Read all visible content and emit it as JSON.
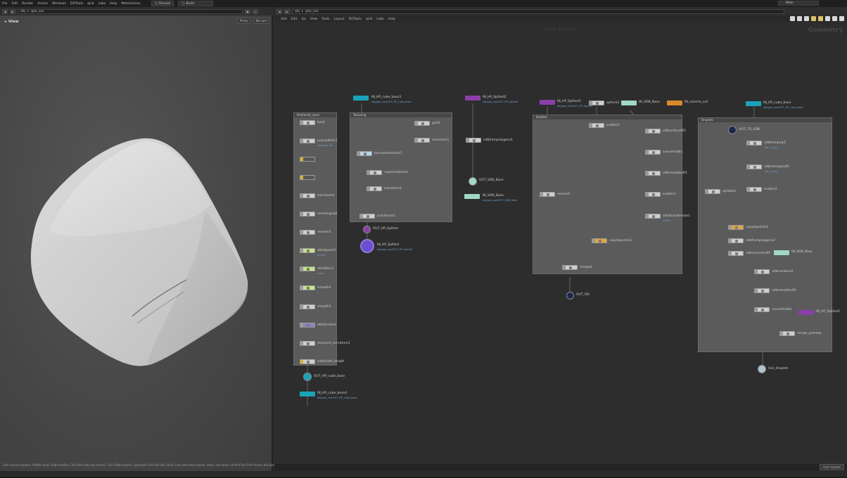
{
  "menubar": {
    "items": [
      "File",
      "Edit",
      "Render",
      "Assets",
      "Windows",
      "DOTools",
      "qLib",
      "Labs",
      "Help",
      "MetaHuman"
    ],
    "desktop_tab": "Recook",
    "desktop_select": "Build",
    "main_label": "Main"
  },
  "viewport": {
    "path": "obj",
    "node": "geo_vox",
    "view_label": "View",
    "persp_label": "Persp",
    "cam_label": "No cam",
    "status_text": "Left mouse tumbles. Middle pans. Right dollies. Ctrl+Alt+Left box zooms. Ctrl+Right zooms. Spacebar-Ctrl-Left tilts. Hold L for alternate tumble, dolly, and zoom. Hold M for First Person Navigation."
  },
  "network": {
    "path": "obj",
    "node": "geo_vox",
    "menus": [
      "Add",
      "Edit",
      "Go",
      "View",
      "Tools",
      "Layout",
      "DOTools",
      "qLib",
      "Labs",
      "Help"
    ],
    "context_label": "Geometry",
    "center_watermark": "Indie Edition",
    "auto_update": "Auto Update"
  },
  "boxes": [
    {
      "id": "polyfamily_base",
      "title": "Polyfamily_base"
    },
    {
      "id": "texturing",
      "title": "Texturing"
    },
    {
      "id": "bubbles",
      "title": "Bubbles"
    },
    {
      "id": "droplets",
      "title": "Droplets"
    }
  ],
  "nodes": {
    "box1": [
      {
        "label": "box1",
        "sub": ""
      },
      {
        "label": "polysplitdiv1",
        "sub": "tangents: fill"
      },
      {
        "label": "",
        "sub": ""
      },
      {
        "label": "",
        "sub": ""
      },
      {
        "label": "transform1",
        "sub": ""
      },
      {
        "label": "remeshgrid2",
        "sub": ""
      },
      {
        "label": "remesh1",
        "sub": ""
      },
      {
        "label": "attribpaint1",
        "sub": "pscale"
      },
      {
        "label": "attribblur1",
        "sub": "mask"
      },
      {
        "label": "smooth2",
        "sub": "0"
      },
      {
        "label": "smooth1",
        "sub": "0"
      },
      {
        "label": "attribnoise1",
        "sub": ""
      },
      {
        "label": "measure_curvature1",
        "sub": ""
      },
      {
        "label": "subdivide_length",
        "sub": ""
      }
    ],
    "tex": [
      {
        "label": "grid1",
        "sub": ""
      },
      {
        "label": "mountain1",
        "sub": ""
      },
      {
        "label": "boundsstretcher1",
        "sub": ""
      },
      {
        "label": "rayhitcollision1",
        "sub": ""
      },
      {
        "label": "transform1",
        "sub": ""
      },
      {
        "label": "pointnorm1",
        "sub": ""
      }
    ],
    "bub": [
      {
        "label": "sphere1",
        "sub": ""
      },
      {
        "label": "IN_VDB_Base",
        "sub": ""
      },
      {
        "label": "IN_volume_out",
        "sub": ""
      },
      {
        "label": "scatter2",
        "sub": ""
      },
      {
        "label": "vdbsurfacefill1",
        "sub": ""
      },
      {
        "label": "convertvdb1",
        "sub": ""
      },
      {
        "label": "vdbsmoothsdf1",
        "sub": ""
      },
      {
        "label": "scatter1",
        "sub": ""
      },
      {
        "label": "attribrandomize1",
        "sub": "pscale"
      },
      {
        "label": "normal1",
        "sub": ""
      },
      {
        "label": "copytopoints1",
        "sub": ""
      },
      {
        "label": "merge4",
        "sub": ""
      }
    ],
    "drop": [
      {
        "label": "OUT_TO_VDB",
        "sub": ""
      },
      {
        "label": "vdbfrompoly1",
        "sub": "vdb_0_vdb"
      },
      {
        "label": "vdbreshapesdf1",
        "sub": "vdb_0_vdb"
      },
      {
        "label": "scatter2",
        "sub": ""
      },
      {
        "label": "splitpts1",
        "sub": ""
      },
      {
        "label": "copytopoints2",
        "sub": ""
      },
      {
        "label": "vdbfrompolygons2",
        "sub": ""
      },
      {
        "label": "vdbconvertsdf1",
        "sub": ""
      },
      {
        "label": "IN_VDB_Base",
        "sub": ""
      },
      {
        "label": "vdbcombine2",
        "sub": ""
      },
      {
        "label": "vdbsmoothsdf1",
        "sub": ""
      },
      {
        "label": "convertvdb3",
        "sub": ""
      },
      {
        "label": "IN_HP_Splited3",
        "sub": ""
      },
      {
        "label": "merge_preview",
        "sub": ""
      },
      {
        "label": "Out_droplets",
        "sub": ""
      }
    ]
  },
  "free_nodes": [
    {
      "label": "IN_HP_cube_base3",
      "path": "obj/geo_vox/OUT_HP_cube_base"
    },
    {
      "label": "IN_HP_Splited2",
      "path": "obj/geo_vox/OUT_HP_Splited"
    },
    {
      "label": "vdbfrompolygons1",
      "path": ""
    },
    {
      "label": "OUT_VDB_Base",
      "path": ""
    },
    {
      "label": "IN_VDB_Base",
      "path": "obj/geo_vox/OUT_VDB_Base"
    },
    {
      "label": "OUT_HP_Splited",
      "path": ""
    },
    {
      "label": "IN_HP_Splited",
      "path": "obj/geo_vox/OUT_HP_Splited"
    },
    {
      "label": "OUT_HP_cube_base",
      "path": ""
    },
    {
      "label": "IN_HP_cube_base4",
      "path": "obj/geo_vox/OUT_HP_cube_base"
    },
    {
      "label": "IN_HP_Splited1",
      "path": "obj/geo_vox/OUT_HP_Splited"
    },
    {
      "label": "IN_HP_cube_base",
      "path": "obj/geo_vox/OUT_HP_cube_base"
    },
    {
      "label": "OUT_SIS",
      "path": ""
    }
  ],
  "colors": {
    "teal": "#1aa3b8",
    "purple": "#8a3fa8",
    "orange": "#d98a2b",
    "mint": "#9fd9c3",
    "yellow": "#e0b23a",
    "green": "#b8e07a",
    "violet_noise": "#8a80c8",
    "navy": "#1b2a4a"
  }
}
